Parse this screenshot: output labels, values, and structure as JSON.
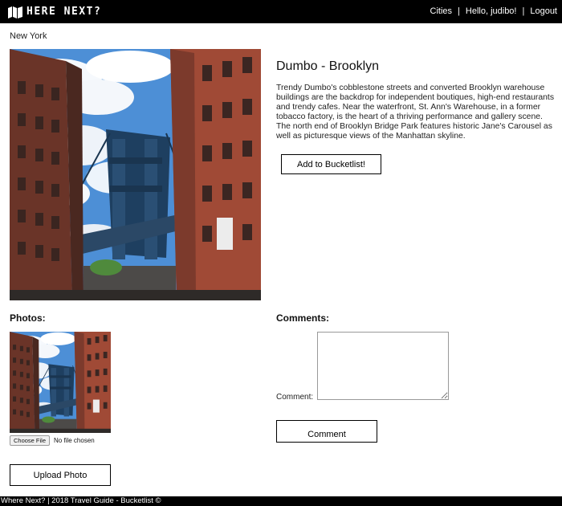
{
  "header": {
    "logo_text": "HERE NEXT?",
    "nav": {
      "cities": "Cities",
      "greeting": "Hello, judibo!",
      "logout": "Logout",
      "separator": "|"
    }
  },
  "city": "New York",
  "detail": {
    "title": "Dumbo - Brooklyn",
    "description": "Trendy Dumbo's cobblestone streets and converted Brooklyn warehouse buildings are the backdrop for independent boutiques, high-end restaurants and trendy cafes. Near the waterfront, St. Ann's Warehouse, in a former tobacco factory, is the heart of a thriving performance and gallery scene. The north end of Brooklyn Bridge Park features historic Jane's Carousel as well as picturesque views of the Manhattan skyline.",
    "bucketlist_button": "Add to Bucketlist!"
  },
  "photos": {
    "heading": "Photos:",
    "file_button": "Choose File",
    "file_status": "No file chosen",
    "upload_button": "Upload Photo"
  },
  "comments": {
    "heading": "Comments:",
    "label": "Comment:",
    "value": "",
    "submit_button": "Comment"
  },
  "footer": {
    "text": "Where Next? | 2018 Travel Guide - Bucketlist ©"
  },
  "icons": {
    "logo": "map-icon"
  },
  "colors": {
    "header_bg": "#000000",
    "footer_bg": "#000000",
    "brick": "#9a4a38",
    "sky": "#4a8fd4"
  }
}
